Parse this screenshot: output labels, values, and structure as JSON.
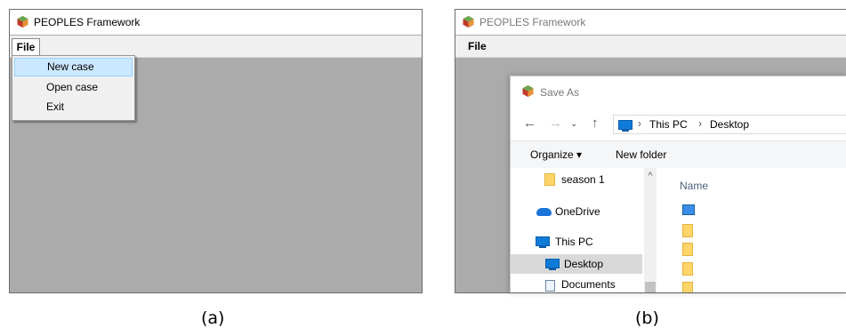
{
  "panel_a": {
    "window_title": "PEOPLES Framework",
    "menu_file": "File",
    "dropdown": {
      "items": [
        {
          "label": "New case",
          "highlighted": true
        },
        {
          "label": "Open case",
          "highlighted": false
        },
        {
          "label": "Exit",
          "highlighted": false
        }
      ]
    },
    "caption": "(a)"
  },
  "panel_b": {
    "window_title": "PEOPLES Framework",
    "menu_file": "File",
    "dialog": {
      "title": "Save As",
      "breadcrumb": [
        "This PC",
        "Desktop"
      ],
      "organize_label": "Organize ▾",
      "new_folder_label": "New folder",
      "tree": [
        {
          "label": "season 1",
          "icon": "folder-icon"
        },
        {
          "label": "OneDrive",
          "icon": "cloud-icon"
        },
        {
          "label": "This PC",
          "icon": "computer-icon"
        },
        {
          "label": "Desktop",
          "icon": "desktop-icon",
          "selected": true
        },
        {
          "label": "Documents",
          "icon": "document-icon"
        }
      ],
      "column_name": "Name"
    },
    "caption": "(b)"
  },
  "colors": {
    "client_gray": "#ababab",
    "highlight": "#cce8ff",
    "folder": "#ffd56a",
    "accent_blue": "#0f7bd8"
  }
}
